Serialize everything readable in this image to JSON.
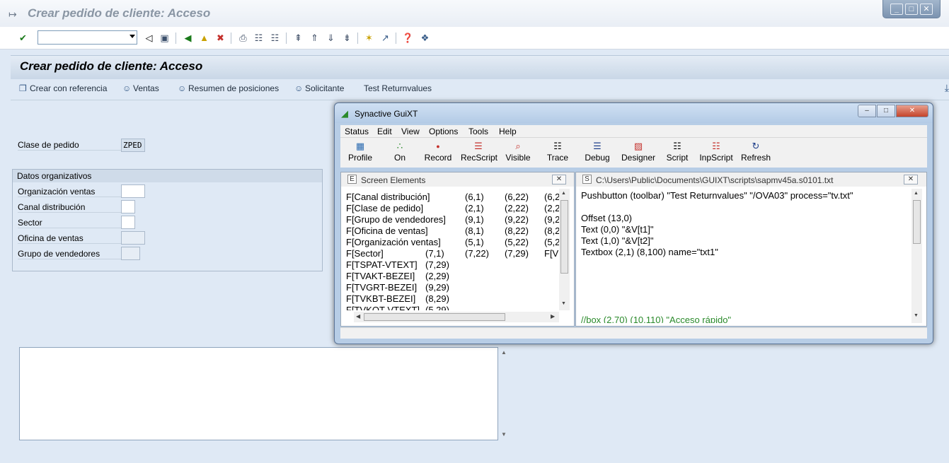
{
  "window": {
    "title": "Crear pedido de cliente: Acceso",
    "controls": [
      "_",
      "□",
      "✕"
    ]
  },
  "toolbar": {
    "command_field_value": ""
  },
  "screen": {
    "title": "Crear pedido de cliente: Acceso",
    "app_buttons": [
      {
        "label": "Crear con referencia",
        "icon": "copy-doc-icon"
      },
      {
        "label": "Ventas",
        "icon": "person-icon"
      },
      {
        "label": "Resumen de posiciones",
        "icon": "person-icon"
      },
      {
        "label": "Solicitante",
        "icon": "person-icon"
      },
      {
        "label": "Test Returnvalues",
        "icon": ""
      }
    ]
  },
  "form": {
    "order_type_label": "Clase de pedido",
    "order_type_value": "ZPED",
    "org_group_title": "Datos organizativos",
    "fields": [
      {
        "label": "Organización ventas",
        "value": ""
      },
      {
        "label": "Canal distribución",
        "value": ""
      },
      {
        "label": "Sector",
        "value": ""
      },
      {
        "label": "Oficina de ventas",
        "value": ""
      },
      {
        "label": "Grupo de vendedores",
        "value": ""
      }
    ]
  },
  "guixt": {
    "title": "Synactive GuiXT",
    "menu": [
      "Status",
      "Edit",
      "View",
      "Options",
      "Tools",
      "Help"
    ],
    "tools": [
      "Profile",
      "On",
      "Record",
      "RecScript",
      "Visible",
      "Trace",
      "Debug",
      "Designer",
      "Script",
      "InpScript",
      "Refresh"
    ],
    "left_pane": {
      "title": "Screen Elements",
      "icon_letter": "E",
      "rows": [
        [
          "F[Canal distribución]",
          "(6,1)",
          "(6,22)",
          "(6,2"
        ],
        [
          "F[Clase de pedido]",
          "(2,1)",
          "(2,22)",
          "(2,2"
        ],
        [
          "F[Grupo de vendedores]",
          "(9,1)",
          "(9,22)",
          "(9,2"
        ],
        [
          "F[Oficina de ventas]",
          "(8,1)",
          "(8,22)",
          "(8,2"
        ],
        [
          "F[Organización ventas]",
          "(5,1)",
          "(5,22)",
          "(5,2"
        ],
        [
          "F[Sector]",
          "(7,1)",
          "(7,22)",
          "(7,29)",
          "F[V"
        ],
        [
          "F[TSPAT-VTEXT]",
          "(7,29)"
        ],
        [
          "F[TVAKT-BEZEI]",
          "(2,29)"
        ],
        [
          "F[TVGRT-BEZEI]",
          "(9,29)"
        ],
        [
          "F[TVKBT-BEZEI]",
          "(8,29)"
        ],
        [
          "F[TVKOT-VTEXT]",
          "(5,29)"
        ]
      ]
    },
    "right_pane": {
      "title": "C:\\Users\\Public\\Documents\\GUIXT\\scripts\\sapmv45a.s0101.txt",
      "icon_letter": "S",
      "lines": [
        "Pushbutton (toolbar) \"Test Returnvalues\" \"/OVA03\" process=\"tv.txt\"",
        "",
        "Offset (13,0)",
        "Text (0,0) \"&V[t1]\"",
        "Text (1,0) \"&V[t2]\"",
        "Textbox (2,1) (8,100) name=\"txt1\""
      ],
      "comment_line": "//box (2,70) (10,110) \"Acceso rápido\""
    }
  }
}
